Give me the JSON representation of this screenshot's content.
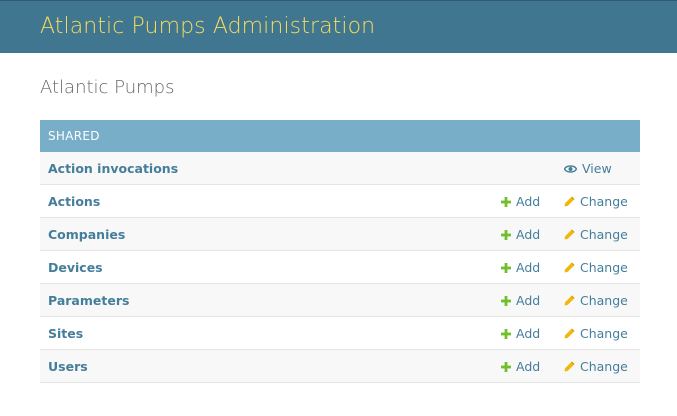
{
  "header": {
    "site_name": "Atlantic Pumps Administration"
  },
  "page": {
    "title": "Atlantic Pumps"
  },
  "module": {
    "caption": "SHARED",
    "rows": [
      {
        "name": "Action invocations",
        "add": null,
        "action": "View",
        "action_icon": "eye-icon"
      },
      {
        "name": "Actions",
        "add": "Add",
        "action": "Change",
        "action_icon": "pencil-icon"
      },
      {
        "name": "Companies",
        "add": "Add",
        "action": "Change",
        "action_icon": "pencil-icon"
      },
      {
        "name": "Devices",
        "add": "Add",
        "action": "Change",
        "action_icon": "pencil-icon"
      },
      {
        "name": "Parameters",
        "add": "Add",
        "action": "Change",
        "action_icon": "pencil-icon"
      },
      {
        "name": "Sites",
        "add": "Add",
        "action": "Change",
        "action_icon": "pencil-icon"
      },
      {
        "name": "Users",
        "add": "Add",
        "action": "Change",
        "action_icon": "pencil-icon"
      }
    ]
  },
  "colors": {
    "header_bg": "#417690",
    "site_name": "#f5dd5d",
    "caption_bg": "#79aec8",
    "link": "#447e9b",
    "add_icon": "#70bf2b",
    "change_icon": "#efb80b",
    "view_icon": "#447e9b"
  }
}
